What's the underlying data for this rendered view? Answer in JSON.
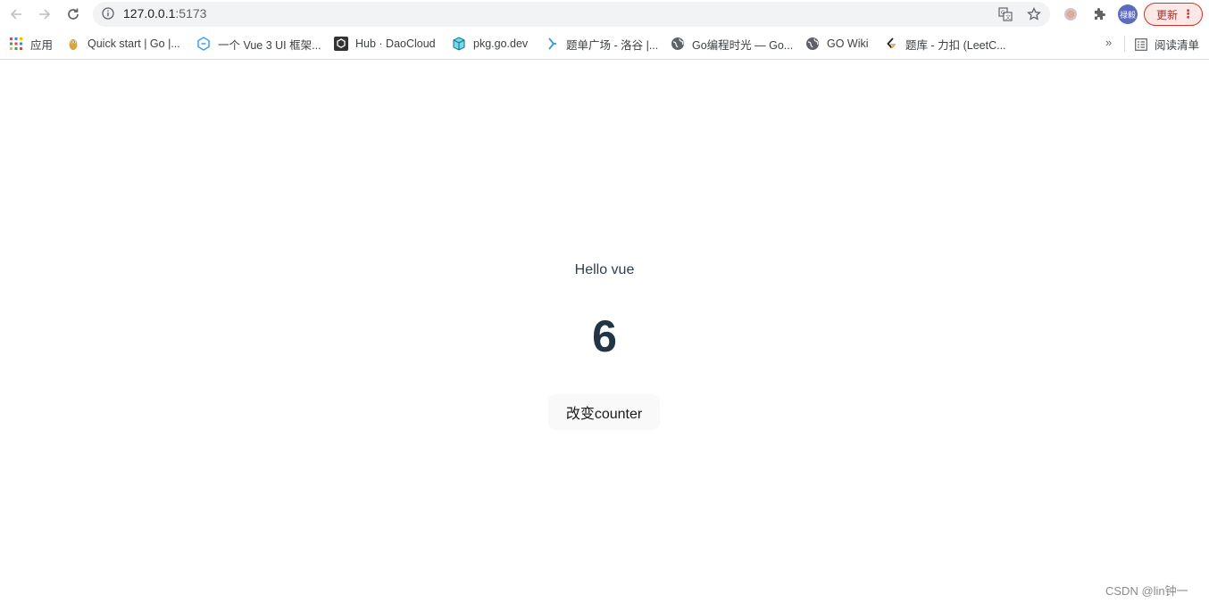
{
  "browser": {
    "url_host": "127.0.0.1",
    "url_port": ":5173",
    "update_label": "更新",
    "avatar_label": "禄毅"
  },
  "bookmarks": {
    "apps_label": "应用",
    "items": [
      {
        "label": "Quick start | Go |...",
        "icon": "gopher-icon"
      },
      {
        "label": "一个 Vue 3 UI 框架...",
        "icon": "element-plus-icon"
      },
      {
        "label": "Hub · DaoCloud",
        "icon": "daocloud-icon"
      },
      {
        "label": "pkg.go.dev",
        "icon": "go-package-icon"
      },
      {
        "label": "题单广场 - 洛谷 |...",
        "icon": "luogu-icon"
      },
      {
        "label": "Go编程时光 — Go...",
        "icon": "globe-icon"
      },
      {
        "label": "GO Wiki",
        "icon": "globe-icon"
      },
      {
        "label": "题库 - 力扣 (LeetC...",
        "icon": "leetcode-icon"
      }
    ],
    "reading_list_label": "阅读清单"
  },
  "app": {
    "message": "Hello vue",
    "counter": "6",
    "button_label": "改变counter"
  },
  "watermark": "CSDN @lin钟一",
  "colors": {
    "heading_text": "#2c3e50",
    "counter_text": "#213547",
    "button_bg": "#f9f9f9",
    "update_accent": "#d93025"
  }
}
